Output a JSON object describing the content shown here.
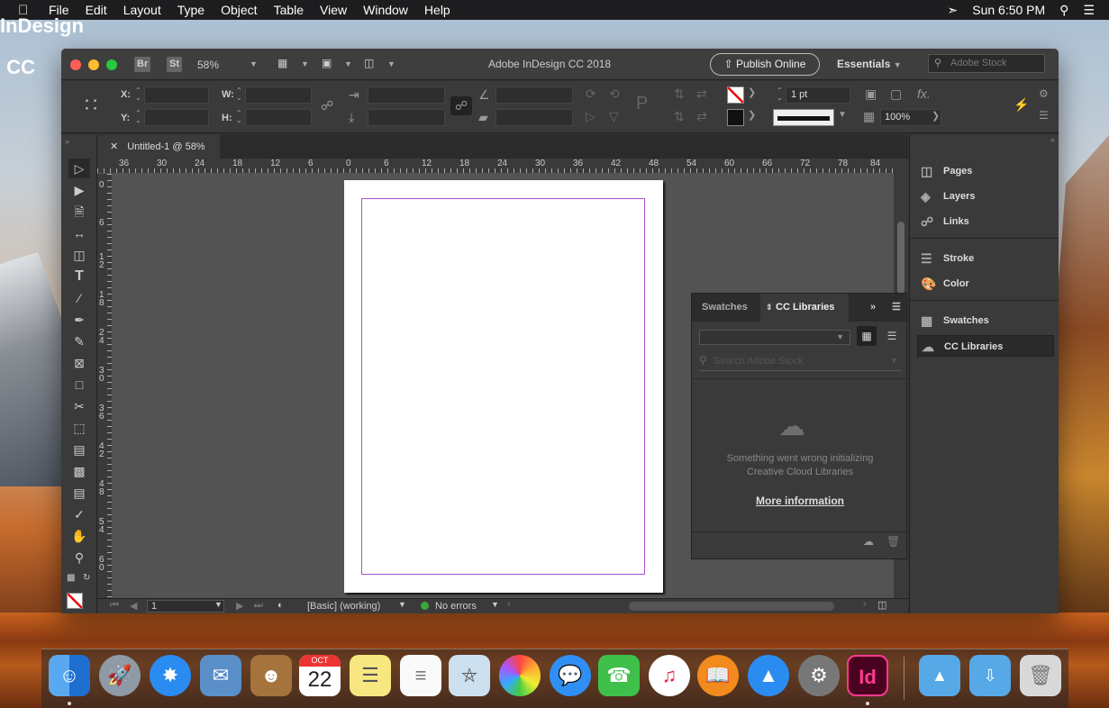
{
  "menubar": {
    "app": "InDesign CC",
    "items": [
      "File",
      "Edit",
      "Layout",
      "Type",
      "Object",
      "Table",
      "View",
      "Window",
      "Help"
    ],
    "clock": "Sun 6:50 PM"
  },
  "titlebar": {
    "bridge": "Br",
    "stock_badge": "St",
    "zoom": "58%",
    "title": "Adobe InDesign CC 2018",
    "publish": "Publish Online",
    "workspace": "Essentials",
    "stock_search_placeholder": "Adobe Stock"
  },
  "control": {
    "x_label": "X:",
    "y_label": "Y:",
    "w_label": "W:",
    "h_label": "H:",
    "stroke_weight": "1 pt",
    "scale": "100%"
  },
  "document": {
    "tab": "Untitled-1 @ 58%"
  },
  "ruler": {
    "h": [
      "36",
      "30",
      "24",
      "18",
      "12",
      "6",
      "0",
      "6",
      "12",
      "18",
      "24",
      "30",
      "36",
      "42",
      "48",
      "54",
      "60",
      "66",
      "72",
      "78",
      "84"
    ],
    "v": [
      "0",
      "6",
      "1 2",
      "1 8",
      "2 4",
      "3 0",
      "3 6",
      "4 2",
      "4 8",
      "5 4",
      "6 0"
    ]
  },
  "status": {
    "page": "1",
    "style": "[Basic] (working)",
    "preflight": "No errors"
  },
  "float_panel": {
    "tab_swatches": "Swatches",
    "tab_libraries": "CC Libraries",
    "search_placeholder": "Search Adobe Stock",
    "error": "Something went wrong initializing Creative Cloud Libraries",
    "more_info": "More information"
  },
  "dock_panel": {
    "items": [
      "Pages",
      "Layers",
      "Links",
      "Stroke",
      "Color",
      "Swatches",
      "CC Libraries"
    ]
  },
  "dock_apps": {
    "calendar_month": "OCT",
    "calendar_day": "22",
    "indesign": "Id"
  }
}
